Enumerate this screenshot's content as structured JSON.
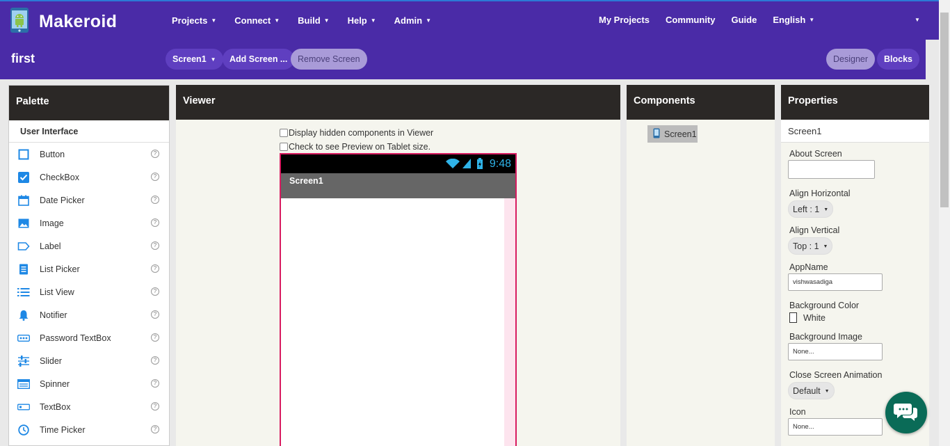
{
  "brand": {
    "name": "Makeroid"
  },
  "menu": {
    "left": [
      "Projects",
      "Connect",
      "Build",
      "Help",
      "Admin"
    ],
    "right": [
      "My Projects",
      "Community",
      "Guide",
      "English"
    ]
  },
  "project": {
    "name": "first"
  },
  "toolbar": {
    "screen_select": "Screen1",
    "add_screen": "Add Screen ...",
    "remove_screen": "Remove Screen",
    "designer": "Designer",
    "blocks": "Blocks"
  },
  "palette": {
    "title": "Palette",
    "category": "User Interface",
    "items": [
      {
        "label": "Button",
        "icon": "button-icon"
      },
      {
        "label": "CheckBox",
        "icon": "checkbox-icon"
      },
      {
        "label": "Date Picker",
        "icon": "calendar-icon"
      },
      {
        "label": "Image",
        "icon": "image-icon"
      },
      {
        "label": "Label",
        "icon": "label-icon"
      },
      {
        "label": "List Picker",
        "icon": "list-picker-icon"
      },
      {
        "label": "List View",
        "icon": "list-view-icon"
      },
      {
        "label": "Notifier",
        "icon": "bell-icon"
      },
      {
        "label": "Password TextBox",
        "icon": "password-icon"
      },
      {
        "label": "Slider",
        "icon": "slider-icon"
      },
      {
        "label": "Spinner",
        "icon": "spinner-icon"
      },
      {
        "label": "TextBox",
        "icon": "textbox-icon"
      },
      {
        "label": "Time Picker",
        "icon": "clock-icon"
      }
    ],
    "help_glyph": "?"
  },
  "viewer": {
    "title": "Viewer",
    "hidden_components": "Display hidden components in Viewer",
    "tablet_preview": "Check to see Preview on Tablet size.",
    "phone": {
      "time": "9:48",
      "screen_title": "Screen1"
    }
  },
  "components": {
    "title": "Components",
    "root": "Screen1"
  },
  "properties": {
    "title": "Properties",
    "selected": "Screen1",
    "about_screen": {
      "label": "About Screen",
      "value": ""
    },
    "align_horizontal": {
      "label": "Align Horizontal",
      "value": "Left : 1"
    },
    "align_vertical": {
      "label": "Align Vertical",
      "value": "Top : 1"
    },
    "app_name": {
      "label": "AppName",
      "value": "vishwasadiga"
    },
    "background_color": {
      "label": "Background Color",
      "value": "White"
    },
    "background_image": {
      "label": "Background Image",
      "value": "None..."
    },
    "close_animation": {
      "label": "Close Screen Animation",
      "value": "Default"
    },
    "icon": {
      "label": "Icon",
      "value": "None..."
    }
  },
  "colors": {
    "brand": "#4a2ba7",
    "panel_header": "#2b2826",
    "accent": "#1e88e5",
    "phone_border": "#d81b60",
    "chat": "#0a6b57"
  }
}
